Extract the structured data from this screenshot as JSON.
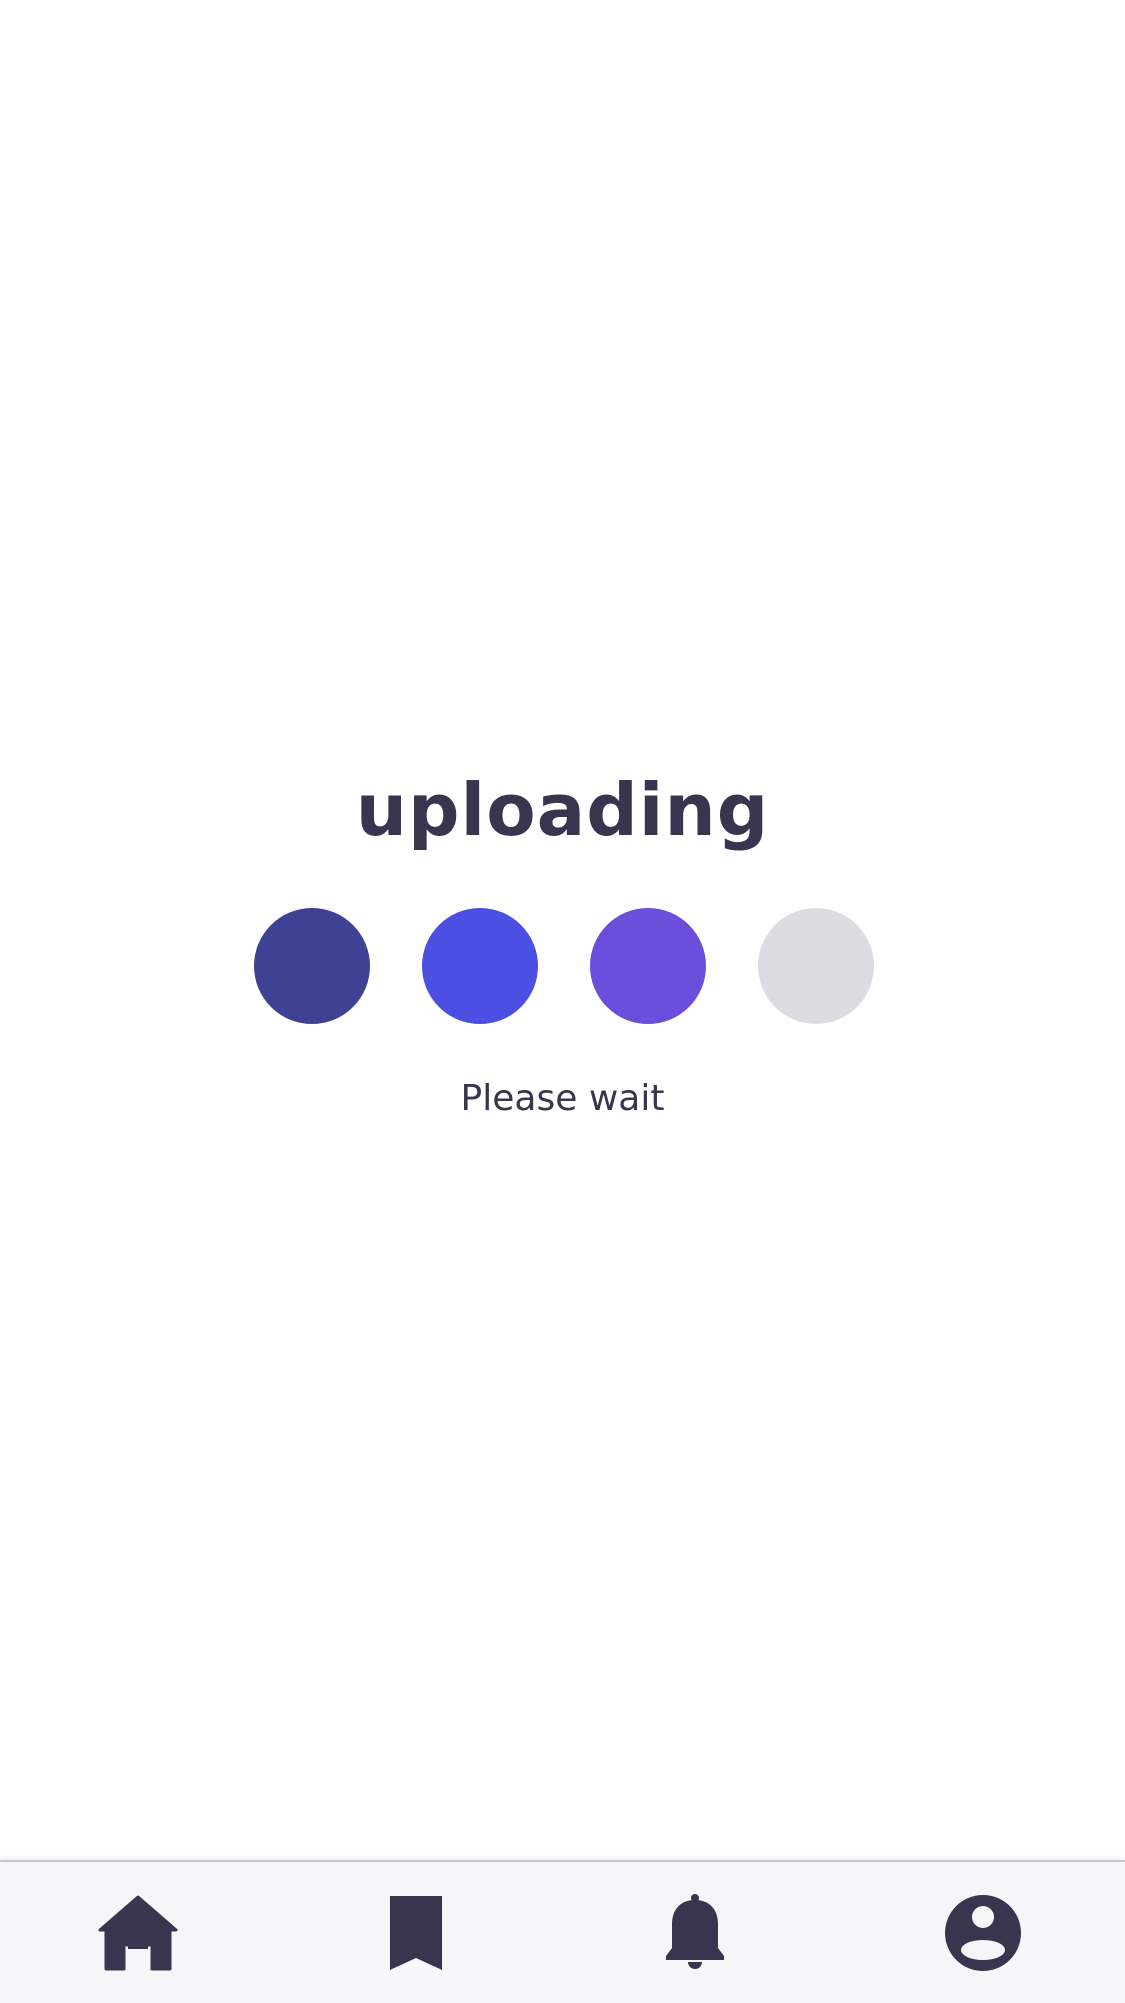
{
  "status": {
    "title": "uploading",
    "message": "Please wait"
  },
  "progress_dots": [
    {
      "color": "#3f4193",
      "state": "complete"
    },
    {
      "color": "#4b50e2",
      "state": "complete"
    },
    {
      "color": "#6d4ddb",
      "state": "complete"
    },
    {
      "color": "#dddce3",
      "state": "pending"
    }
  ],
  "colors": {
    "text": "#3a354f",
    "icon": "#3a354f",
    "tab_bar_background": "#f6f6f9"
  },
  "tab_bar": {
    "items": [
      {
        "icon": "home-icon"
      },
      {
        "icon": "bookmark-icon"
      },
      {
        "icon": "bell-icon"
      },
      {
        "icon": "user-circle-icon"
      }
    ]
  }
}
